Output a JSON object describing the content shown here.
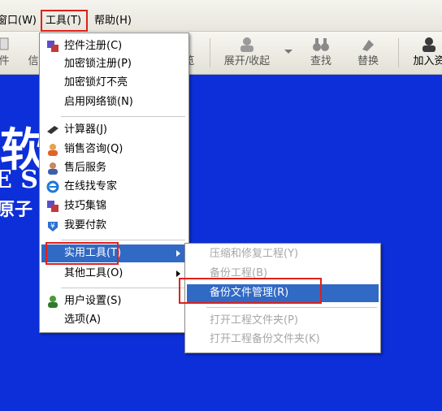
{
  "menubar": {
    "items": [
      {
        "label": "窗口(W)",
        "name": "menu-window"
      },
      {
        "label": "工具(T)",
        "name": "menu-tools"
      },
      {
        "label": "帮助(H)",
        "name": "menu-help"
      }
    ]
  },
  "toolbar": {
    "buttons": [
      {
        "label": "件"
      },
      {
        "label": "信"
      },
      {
        "label": "览"
      },
      {
        "label": "展开/收起"
      },
      {
        "label": "查找"
      },
      {
        "label": "替换"
      },
      {
        "label": "加入资"
      }
    ]
  },
  "background": {
    "brand_char": "软",
    "brand_sub": "E SO",
    "brand_small": "原子"
  },
  "tools_menu": {
    "items": [
      {
        "label": "控件注册(C)",
        "icon": "control-register-icon"
      },
      {
        "label": "加密锁注册(P)",
        "icon": ""
      },
      {
        "label": "加密锁灯不亮",
        "icon": ""
      },
      {
        "label": "启用网络锁(N)",
        "icon": ""
      },
      {
        "label": "计算器(J)",
        "icon": "calculator-icon"
      },
      {
        "label": "销售咨询(Q)",
        "icon": "sales-person-icon"
      },
      {
        "label": "售后服务",
        "icon": "service-person-icon"
      },
      {
        "label": "在线找专家",
        "icon": "internet-explorer-icon"
      },
      {
        "label": "技巧集锦",
        "icon": "tips-icon"
      },
      {
        "label": "我要付款",
        "icon": "payment-icon"
      },
      {
        "label": "实用工具(T)",
        "icon": ""
      },
      {
        "label": "其他工具(O)",
        "icon": ""
      },
      {
        "label": "用户设置(S)",
        "icon": "user-settings-icon"
      },
      {
        "label": "选项(A)",
        "icon": ""
      }
    ]
  },
  "utility_submenu": {
    "items": [
      {
        "label": "压缩和修复工程(Y)",
        "enabled": false
      },
      {
        "label": "备份工程(B)",
        "enabled": false
      },
      {
        "label": "备份文件管理(R)",
        "enabled": true
      },
      {
        "label": "打开工程文件夹(P)",
        "enabled": false
      },
      {
        "label": "打开工程备份文件夹(K)",
        "enabled": false
      }
    ]
  },
  "colors": {
    "desktop_blue": "#0d2fd9",
    "selection": "#316ac5",
    "highlight_box": "#e0201a"
  }
}
